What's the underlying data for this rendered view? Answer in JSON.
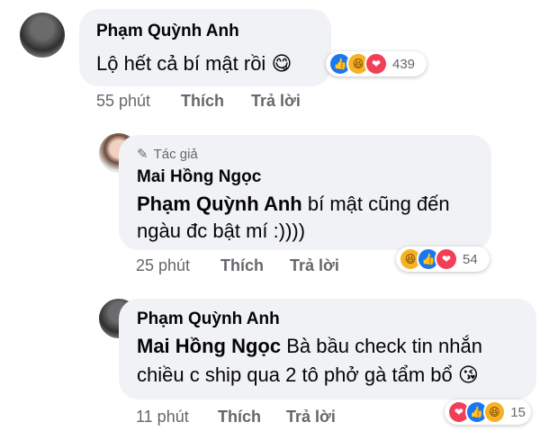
{
  "colors": {
    "like": "#1877f2",
    "love": "#f33e58",
    "haha": "#f7b125",
    "meta_text": "#65676b",
    "bubble": "#f0f2f5"
  },
  "comments": [
    {
      "author": "Phạm Quỳnh Anh",
      "text": "Lộ hết cả bí mật rồi",
      "emoji": "😋",
      "time": "55 phút",
      "like_label": "Thích",
      "reply_label": "Trả lời",
      "reactions": [
        "like-icon",
        "haha-icon",
        "love-icon"
      ],
      "reaction_count": "439"
    },
    {
      "author_tag": "Tác giả",
      "author": "Mai Hồng Ngọc",
      "mention": "Phạm Quỳnh Anh",
      "text_line1": "bí mật cũng đến",
      "text_line2": "ngàu đc bật mí :))))",
      "time": "25 phút",
      "like_label": "Thích",
      "reply_label": "Trả lời",
      "reactions": [
        "haha-icon",
        "like-icon",
        "love-icon"
      ],
      "reaction_count": "54"
    },
    {
      "author": "Phạm Quỳnh Anh",
      "mention": "Mai Hồng Ngọc",
      "text_line1": "Bà bầu check tin nhắn",
      "text_line2": "chiều c ship qua 2 tô phở gà tẩm bổ",
      "emoji": "😘",
      "time": "11 phút",
      "like_label": "Thích",
      "reply_label": "Trả lời",
      "reactions": [
        "love-icon",
        "like-icon",
        "haha-icon"
      ],
      "reaction_count": "15"
    }
  ]
}
